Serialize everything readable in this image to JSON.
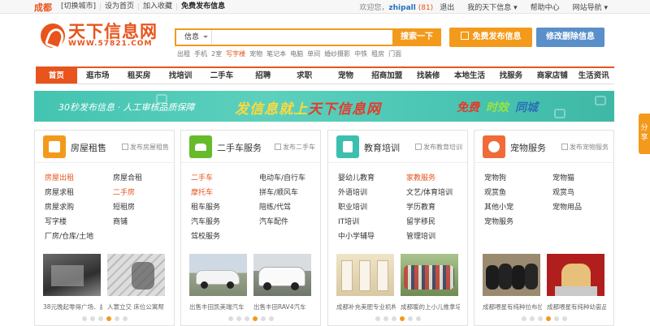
{
  "topbar": {
    "city": "成都",
    "left_links": [
      "[切换城市]",
      "设为首页",
      "加入收藏",
      "免费发布信息"
    ],
    "welcome": "欢迎您，",
    "user": "zhipall",
    "count": "(81)",
    "right_links": [
      "退出",
      "我的天下信息 ▾",
      "帮助中心",
      "网站导航 ▾"
    ]
  },
  "logo": {
    "name": "天下信息网",
    "url": "WWW.57821.COM"
  },
  "search": {
    "category": "信息",
    "placeholder": "",
    "button": "搜索一下"
  },
  "hot_words": [
    "出租",
    "手机",
    "2室",
    "写字楼",
    "宠物",
    "笔记本",
    "电脑",
    "单间",
    "婚纱摄影",
    "中铁",
    "租房",
    "门面"
  ],
  "buttons": {
    "post": "免费发布信息",
    "edit": "修改删除信息"
  },
  "nav": [
    "首页",
    "逛市场",
    "租买房",
    "找培训",
    "二手车",
    "招聘",
    "求职",
    "宠物",
    "招商加盟",
    "找装修",
    "本地生活",
    "找服务",
    "商家店铺",
    "生活资讯"
  ],
  "banner": {
    "left": "30秒发布信息 · 人工审核品质保障",
    "main_a": "发信息就上",
    "main_b": "天下信息网",
    "free": "免费",
    "timely": "时效",
    "local": "同城"
  },
  "side_tab": "分享",
  "colors": {
    "brand": "#e8541c",
    "accent": "#f39a1c",
    "blue": "#5a8fc9",
    "teal": "#43c4b1"
  },
  "cards": [
    {
      "title": "房屋租售",
      "publish": "发布房屋租售",
      "icon": "house-icon",
      "color": "#f39a1c",
      "links": [
        "房屋出租",
        "房屋合租",
        "房屋求租",
        "二手房",
        "房屋求购",
        "短租房",
        "写字楼",
        "商铺",
        "厂房/仓库/土地"
      ],
      "captions": [
        "38元晚起零得广场、盐",
        "人寰立交 床位公寓帮"
      ]
    },
    {
      "title": "二手车服务",
      "publish": "发布二手车",
      "icon": "car-icon",
      "color": "#66bb2a",
      "links": [
        "二手车",
        "电动车/自行车",
        "摩托车",
        "拼车/顺风车",
        "租车服务",
        "陪练/代驾",
        "汽车服务",
        "汽车配件",
        "驾校服务"
      ],
      "captions": [
        "出售丰田凯美瑞汽车",
        "出售丰田RAV4汽车"
      ]
    },
    {
      "title": "教育培训",
      "publish": "发布教育培训",
      "icon": "book-icon",
      "color": "#3cbfae",
      "links": [
        "婴幼儿教育",
        "家教服务",
        "外语培训",
        "文艺/体育培训",
        "职业培训",
        "学历教育",
        "IT培训",
        "留学移民",
        "中小学辅导",
        "管理培训"
      ],
      "captions": [
        "成都补充美肥专业机构",
        "成都暖的上小儿推拿培训"
      ]
    },
    {
      "title": "宠物服务",
      "publish": "发布宠物服务",
      "icon": "paw-icon",
      "color": "#f06a3a",
      "links": [
        "宠物狗",
        "宠物猫",
        "观赏鱼",
        "观赏鸟",
        "其他小宠",
        "宠物用品",
        "宠物服务"
      ],
      "captions": [
        "成都喂星有纯种拉布拉",
        "成都喂星有纯种幼崽品质"
      ]
    }
  ]
}
